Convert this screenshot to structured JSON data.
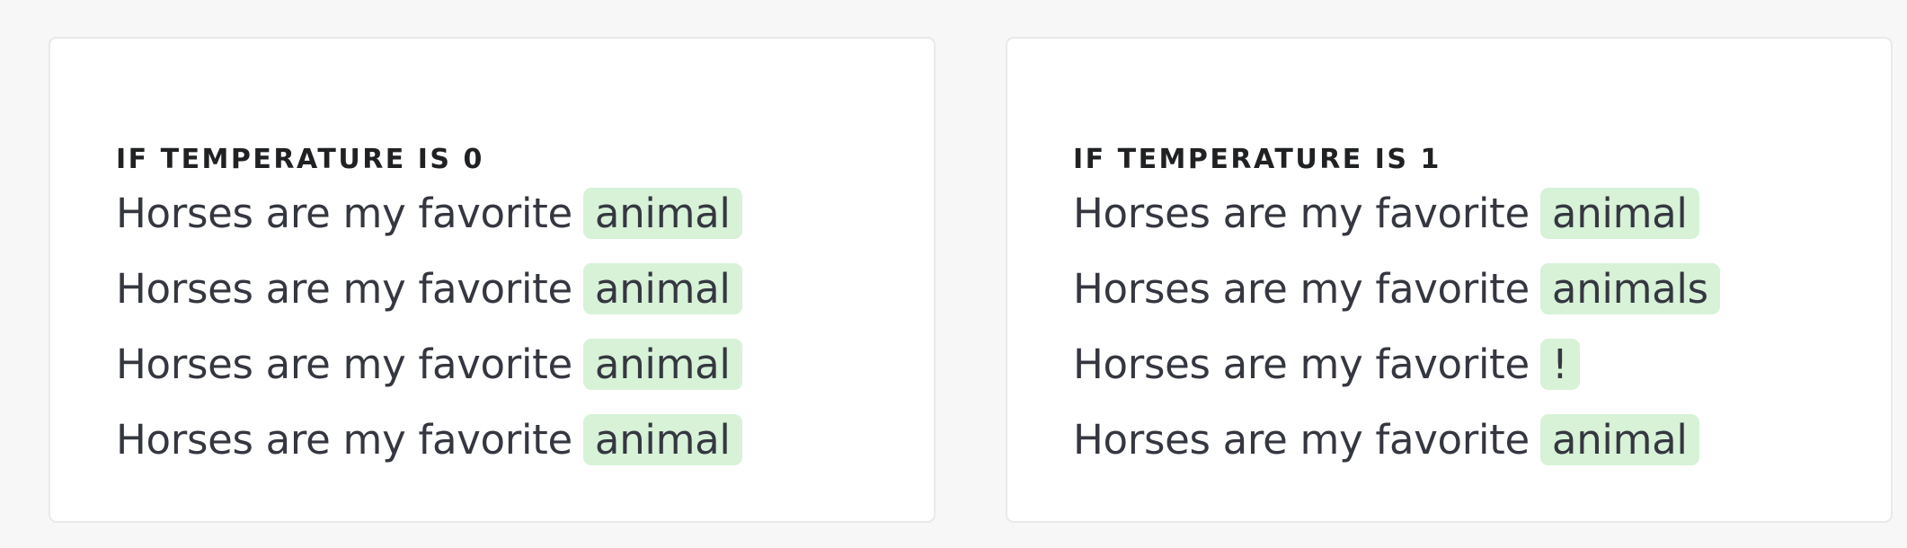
{
  "panels": [
    {
      "title": "IF TEMPERATURE IS 0",
      "rows": [
        {
          "prompt": "Horses are my favorite",
          "completion": "animal"
        },
        {
          "prompt": "Horses are my favorite",
          "completion": "animal"
        },
        {
          "prompt": "Horses are my favorite",
          "completion": "animal"
        },
        {
          "prompt": "Horses are my favorite",
          "completion": "animal"
        }
      ]
    },
    {
      "title": "IF TEMPERATURE IS 1",
      "rows": [
        {
          "prompt": "Horses are my favorite",
          "completion": "animal"
        },
        {
          "prompt": "Horses are my favorite",
          "completion": "animals"
        },
        {
          "prompt": "Horses are my favorite",
          "completion": "!"
        },
        {
          "prompt": "Horses are my favorite",
          "completion": "animal"
        }
      ]
    }
  ],
  "colors": {
    "background": "#f7f7f7",
    "card": "#ffffff",
    "card_border": "#e9e9ec",
    "title_text": "#202123",
    "body_text": "#353740",
    "completion_highlight": "#d7f2d7"
  }
}
